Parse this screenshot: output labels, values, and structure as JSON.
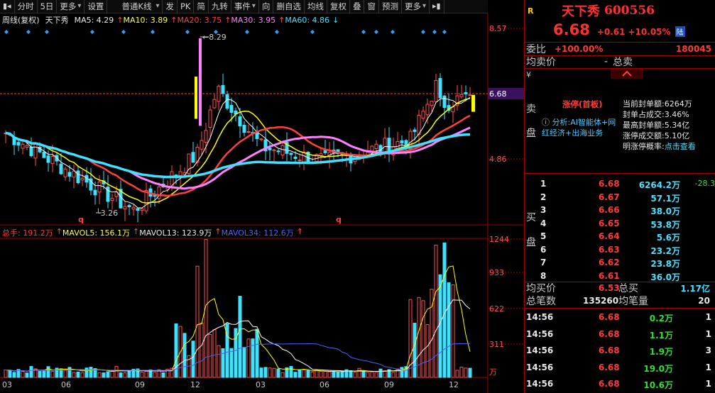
{
  "toolbar": {
    "items": [
      "分时",
      "5日",
      "更多",
      "设置",
      "普通K线",
      "发",
      "PK",
      "简",
      "九转",
      "事件",
      "向",
      "删自选",
      "均线",
      "复权",
      "叠",
      "窗",
      "预测",
      "更多"
    ]
  },
  "indicators": {
    "period": "周线(复权)",
    "stock": "天下秀",
    "ma5": "MA5: 4.29",
    "ma10": "MA10: 3.89",
    "ma20": "MA20: 3.75",
    "ma30": "MA30: 3.95",
    "ma60": "MA60: 4.86",
    "colors": {
      "ma5": "#ffffff",
      "ma10": "#ffff00",
      "ma20": "#ff4040",
      "ma30": "#ff80ff",
      "ma60": "#40e0ff"
    }
  },
  "price_axis": {
    "top": "8.57",
    "mid": "6.68",
    "low": "4.86"
  },
  "annotations": {
    "high_label": "8.29",
    "low_label": "3.26",
    "q1": "q",
    "q2": "q"
  },
  "volume": {
    "total": "总手: 191.2万",
    "mavol5": "MAVOL5: 156.1万",
    "mavol13": "MAVOL13: 123.9万",
    "mavol34": "MAVOL34: 112.6万",
    "axis": [
      "1244",
      "933",
      "622",
      "311",
      "万"
    ]
  },
  "x_axis": [
    "03",
    "06",
    "09",
    "12",
    "03",
    "06",
    "09",
    "12"
  ],
  "quote": {
    "r_label": "R",
    "name": "天下秀",
    "code": "600556",
    "price": "6.68",
    "change": "+0.61",
    "pct": "+10.05%",
    "exchange_badge": "陆",
    "weibi_label": "委比",
    "weibi": "+100.00%",
    "weicha": "180045",
    "sell_avg_label": "均卖价",
    "sell_total_label": "总卖",
    "sell_total": "-",
    "sell_side": [
      "卖",
      "盘"
    ],
    "zt_title": "涨停(首板)",
    "analysis": "分析:AI智能体+网红经济+出海业务",
    "zt_stats": [
      {
        "label": "当前封单额:",
        "value": "6264万"
      },
      {
        "label": "封单占成交:",
        "value": "3.46%"
      },
      {
        "label": "最高封单额:",
        "value": "5.34亿"
      },
      {
        "label": "涨停成交额:",
        "value": "5.10亿"
      },
      {
        "label": "明涨停概率:",
        "value": "点击查看"
      }
    ],
    "buy_side": [
      "买",
      "盘"
    ],
    "bids": [
      {
        "lvl": "1",
        "price": "6.68",
        "vol": "6264.2万",
        "chg": "-28.3"
      },
      {
        "lvl": "2",
        "price": "6.67",
        "vol": "57.1万",
        "chg": ""
      },
      {
        "lvl": "3",
        "price": "6.66",
        "vol": "38.0万",
        "chg": ""
      },
      {
        "lvl": "4",
        "price": "6.65",
        "vol": "53.8万",
        "chg": ""
      },
      {
        "lvl": "5",
        "price": "6.64",
        "vol": "5.6万",
        "chg": ""
      },
      {
        "lvl": "6",
        "price": "6.63",
        "vol": "23.2万",
        "chg": ""
      },
      {
        "lvl": "7",
        "price": "6.62",
        "vol": "23.8万",
        "chg": ""
      },
      {
        "lvl": "8",
        "price": "6.61",
        "vol": "36.0万",
        "chg": ""
      }
    ],
    "buy_avg_label": "均买价",
    "buy_avg": "6.53",
    "buy_total_label": "总买",
    "buy_total": "1.17亿",
    "total_trades_label": "总笔数",
    "total_trades": "135260",
    "avg_trade_label": "均笔量",
    "avg_trade": "20",
    "ticks": [
      {
        "time": "14:56",
        "price": "6.68",
        "vol": "0.2万",
        "n": "1"
      },
      {
        "time": "14:56",
        "price": "6.68",
        "vol": "1.1万",
        "n": "1"
      },
      {
        "time": "14:56",
        "price": "6.68",
        "vol": "1.9万",
        "n": "3"
      },
      {
        "time": "14:56",
        "price": "6.68",
        "vol": "19.0万",
        "n": "1"
      },
      {
        "time": "14:56",
        "price": "6.68",
        "vol": "10.6万",
        "n": "1"
      }
    ]
  }
}
